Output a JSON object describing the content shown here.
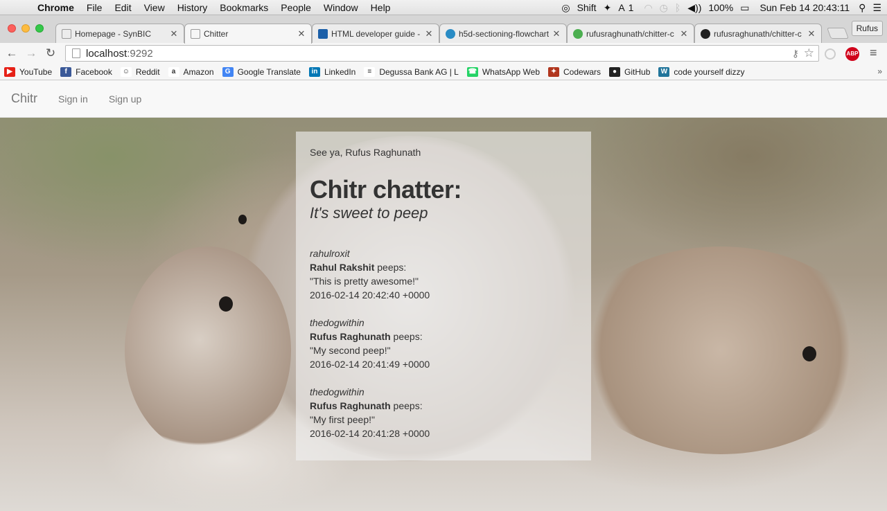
{
  "menubar": {
    "app_name": "Chrome",
    "items": [
      "File",
      "Edit",
      "View",
      "History",
      "Bookmarks",
      "People",
      "Window",
      "Help"
    ],
    "status": {
      "shift": "Shift",
      "badge_count": "1",
      "battery": "100%",
      "datetime": "Sun Feb 14  20:43:11"
    }
  },
  "tabs": [
    {
      "title": "Homepage - SynBIC",
      "favicon_color": "#bbbbbb"
    },
    {
      "title": "Chitter",
      "favicon_color": "#bbbbbb"
    },
    {
      "title": "HTML developer guide - ·",
      "favicon_color": "#1b5fa8"
    },
    {
      "title": "h5d-sectioning-flowchart",
      "favicon_color": "#2a8cc5"
    },
    {
      "title": "rufusraghunath/chitter-c",
      "favicon_color": "#4caf50"
    },
    {
      "title": "rufusraghunath/chitter-c",
      "favicon_color": "#222222"
    }
  ],
  "profile_name": "Rufus",
  "address_bar": {
    "host": "localhost",
    "port": ":9292"
  },
  "bookmarks": [
    {
      "label": "YouTube",
      "icon": "youtube-icon",
      "color": "#e62117",
      "glyph": "▶"
    },
    {
      "label": "Facebook",
      "icon": "facebook-icon",
      "color": "#3b5998",
      "glyph": "f"
    },
    {
      "label": "Reddit",
      "icon": "reddit-icon",
      "color": "#ffffff",
      "glyph": "☺"
    },
    {
      "label": "Amazon",
      "icon": "amazon-icon",
      "color": "#ffffff",
      "glyph": "a"
    },
    {
      "label": "Google Translate",
      "icon": "google-translate-icon",
      "color": "#4285f4",
      "glyph": "G"
    },
    {
      "label": "LinkedIn",
      "icon": "linkedin-icon",
      "color": "#0077b5",
      "glyph": "in"
    },
    {
      "label": "Degussa Bank AG | L",
      "icon": "degussa-icon",
      "color": "#ffffff",
      "glyph": "≡"
    },
    {
      "label": "WhatsApp Web",
      "icon": "whatsapp-icon",
      "color": "#25d366",
      "glyph": "☎"
    },
    {
      "label": "Codewars",
      "icon": "codewars-icon",
      "color": "#b1361e",
      "glyph": "✦"
    },
    {
      "label": "GitHub",
      "icon": "github-icon",
      "color": "#222222",
      "glyph": "●"
    },
    {
      "label": "code yourself dizzy",
      "icon": "wordpress-icon",
      "color": "#21759b",
      "glyph": "W"
    }
  ],
  "site": {
    "brand": "Chitr",
    "nav": [
      "Sign in",
      "Sign up"
    ],
    "greeting": "See ya, Rufus Raghunath",
    "heading": "Chitr chatter:",
    "tagline": "It's sweet to peep",
    "peeps_verb": "peeps:",
    "peeps": [
      {
        "handle": "rahulroxit",
        "author": "Rahul Rakshit",
        "text": "\"This is pretty awesome!\"",
        "timestamp": "2016-02-14 20:42:40 +0000"
      },
      {
        "handle": "thedogwithin",
        "author": "Rufus Raghunath",
        "text": "\"My second peep!\"",
        "timestamp": "2016-02-14 20:41:49 +0000"
      },
      {
        "handle": "thedogwithin",
        "author": "Rufus Raghunath",
        "text": "\"My first peep!\"",
        "timestamp": "2016-02-14 20:41:28 +0000"
      }
    ]
  }
}
